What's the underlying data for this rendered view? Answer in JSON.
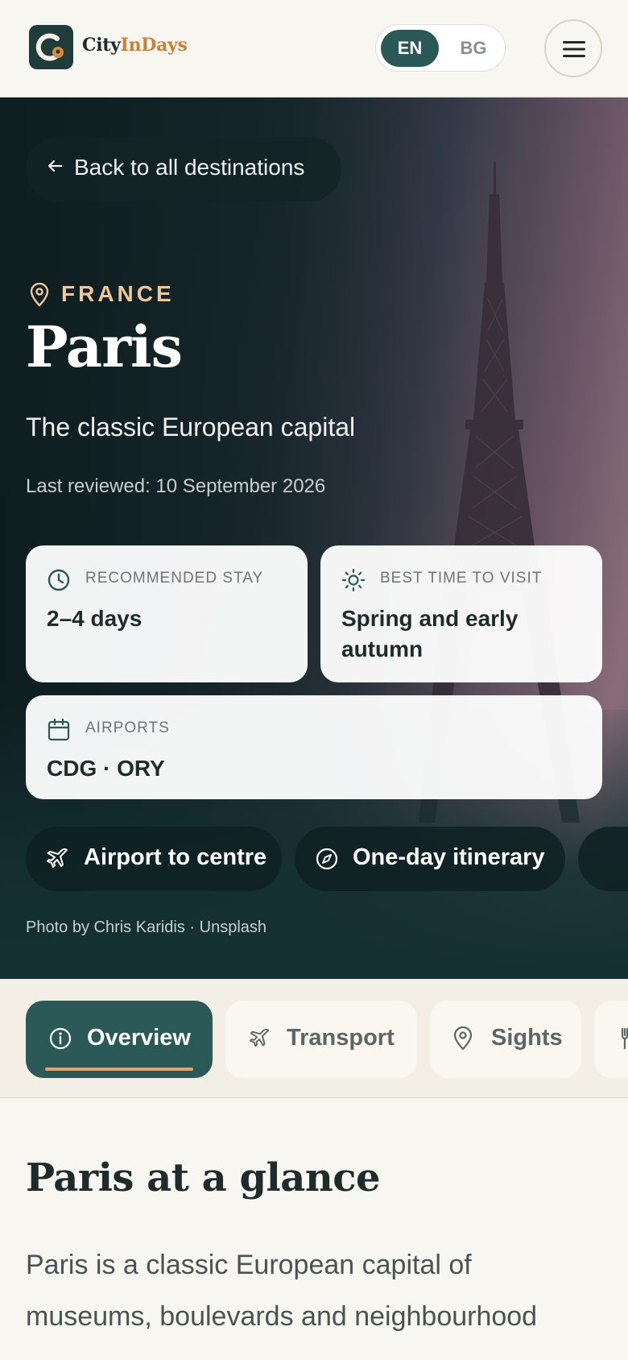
{
  "header": {
    "logo_part1": "City",
    "logo_part2": "InDays",
    "lang_en": "EN",
    "lang_bg": "BG",
    "menu_icon": "hamburger-icon"
  },
  "hero": {
    "back_label": "Back to all destinations",
    "country": "FRANCE",
    "city": "Paris",
    "tagline": "The classic European capital",
    "reviewed": "Last reviewed: 10 September 2026",
    "cards": {
      "stay": {
        "key": "RECOMMENDED STAY",
        "value": "2–4 days",
        "icon": "clock-icon"
      },
      "best_time": {
        "key": "BEST TIME TO VISIT",
        "value": "Spring and early autumn",
        "icon": "sun-icon"
      },
      "airports": {
        "key": "AIRPORTS",
        "value": "CDG · ORY",
        "icon": "calendar-icon"
      }
    },
    "quick_links": [
      {
        "label": "Airport to centre",
        "icon": "plane-icon"
      },
      {
        "label": "One-day itinerary",
        "icon": "compass-icon"
      }
    ],
    "photo_credit": "Photo by Chris Karidis · Unsplash"
  },
  "tabs": [
    {
      "label": "Overview",
      "icon": "info-icon",
      "active": true
    },
    {
      "label": "Transport",
      "icon": "plane-icon",
      "active": false
    },
    {
      "label": "Sights",
      "icon": "pin-icon",
      "active": false
    }
  ],
  "content": {
    "title": "Paris at a glance",
    "intro": "Paris is a classic European capital of museums, boulevards and neighbourhood"
  },
  "colors": {
    "brand_dark": "#2b5957",
    "accent": "#c98235",
    "country_text": "#f0c79a",
    "background": "#f8f6f1"
  }
}
